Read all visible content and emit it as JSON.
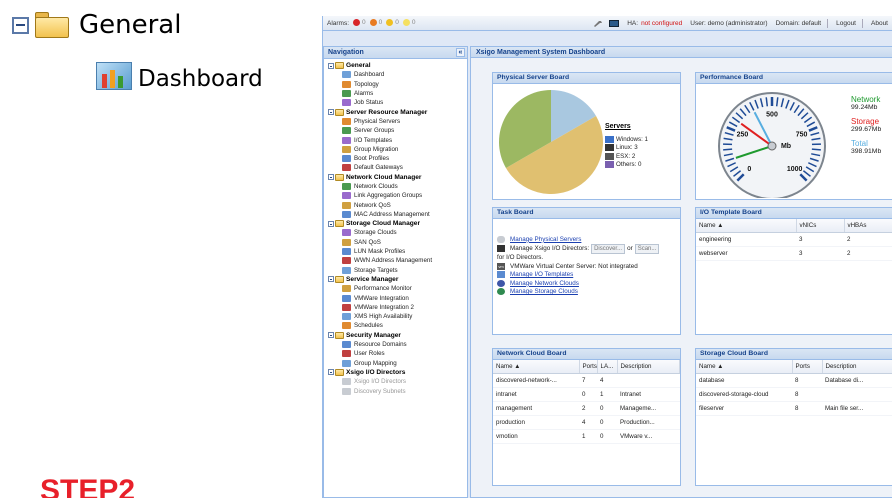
{
  "callout": {
    "general_label": "General",
    "dashboard_label": "Dashboard",
    "step_label": "STEP2"
  },
  "topbar": {
    "alarms_label": "Alarms:",
    "alarm_counts": [
      "0",
      "0",
      "0",
      "0"
    ],
    "alarm_colors": [
      "#d8262a",
      "#e87b22",
      "#f0c020",
      "#f5e060"
    ],
    "ha_label": "HA:",
    "ha_status": "not configured",
    "user_text": "User: demo (administrator)",
    "domain_text": "Domain: default",
    "logout_label": "Logout",
    "about_label": "About"
  },
  "nav": {
    "title": "Navigation",
    "collapse_glyph": "«",
    "categories": [
      {
        "label": "General",
        "items": [
          "Dashboard",
          "Topology",
          "Alarms",
          "Job Status"
        ]
      },
      {
        "label": "Server Resource Manager",
        "items": [
          "Physical Servers",
          "Server Groups",
          "I/O Templates",
          "Group Migration",
          "Boot Profiles",
          "Default Gateways"
        ]
      },
      {
        "label": "Network Cloud Manager",
        "items": [
          "Network Clouds",
          "Link Aggregation Groups",
          "Network QoS",
          "MAC Address Management"
        ]
      },
      {
        "label": "Storage Cloud Manager",
        "items": [
          "Storage Clouds",
          "SAN QoS",
          "LUN Mask Profiles",
          "WWN Address Management",
          "Storage Targets"
        ]
      },
      {
        "label": "Service Manager",
        "items": [
          "Performance Monitor",
          "VMWare Integration",
          "VMWare Integration 2",
          "XMS High Availability",
          "Schedules"
        ]
      },
      {
        "label": "Security Manager",
        "items": [
          "Resource Domains",
          "User Roles",
          "Group Mapping"
        ]
      },
      {
        "label": "Xsigo I/O Directors",
        "items": [
          "Xsigo I/O Directors",
          "Discovery Subnets"
        ]
      }
    ]
  },
  "main": {
    "title": "Xsigo Management System Dashboard"
  },
  "physical_board": {
    "title": "Physical Server Board",
    "legend_title": "Servers",
    "legend": [
      {
        "label": "Windows: 1",
        "icon": "windows-icon"
      },
      {
        "label": "Linux: 3",
        "icon": "linux-icon"
      },
      {
        "label": "ESX: 2",
        "icon": "vmware-icon"
      },
      {
        "label": "Others: 0",
        "icon": "others-icon"
      }
    ],
    "pie_colors": [
      "#a9c8e0",
      "#e0c070",
      "#9cb862"
    ]
  },
  "perf_board": {
    "title": "Performance Board",
    "gauge_unit": "Mb",
    "gauge_ticks": [
      "0",
      "250",
      "500",
      "750",
      "1000"
    ],
    "metrics": [
      {
        "name": "Network",
        "value": "99.24Mb",
        "color": "#1f9a2f"
      },
      {
        "name": "Storage",
        "value": "299.67Mb",
        "color": "#e02020"
      },
      {
        "name": "Total",
        "value": "398.91Mb",
        "color": "#58aee0"
      }
    ]
  },
  "task_board": {
    "title": "Task Board",
    "manage_physical": "Manage Physical Servers",
    "manage_xsigo_prefix": "Manage Xsigo I/O Directors:",
    "discover_button": "Discover...",
    "or_text": "or",
    "scan_button": "Scan...",
    "for_text": "for I/O Directors.",
    "vmware_status": "VMWare Virtual Center Server: Not integrated",
    "manage_templates": "Manage I/O Templates",
    "manage_network": "Manage Network Clouds",
    "manage_storage": "Manage Storage Clouds"
  },
  "iot_board": {
    "title": "I/O Template Board",
    "columns": [
      "Name ▲",
      "vNICs",
      "vHBAs"
    ],
    "rows": [
      [
        "engineering",
        "3",
        "2"
      ],
      [
        "webserver",
        "3",
        "2"
      ]
    ]
  },
  "network_board": {
    "title": "Network Cloud Board",
    "columns": [
      "Name ▲",
      "Ports",
      "LA...",
      "Description"
    ],
    "rows": [
      [
        "discovered-network-...",
        "7",
        "4",
        ""
      ],
      [
        "intranet",
        "0",
        "1",
        "Intranet"
      ],
      [
        "management",
        "2",
        "0",
        "Manageme..."
      ],
      [
        "production",
        "4",
        "0",
        "Production..."
      ],
      [
        "vmotion",
        "1",
        "0",
        "VMware v..."
      ]
    ]
  },
  "storage_board": {
    "title": "Storage Cloud Board",
    "columns": [
      "Name ▲",
      "Ports",
      "Description"
    ],
    "rows": [
      [
        "database",
        "8",
        "Database di..."
      ],
      [
        "discovered-storage-cloud",
        "8",
        ""
      ],
      [
        "fileserver",
        "8",
        "Main file ser..."
      ]
    ]
  }
}
